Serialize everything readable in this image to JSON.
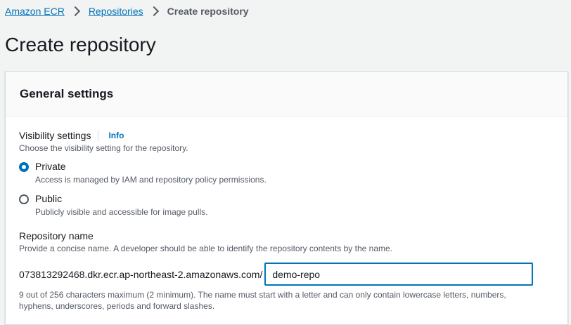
{
  "breadcrumb": {
    "items": [
      {
        "label": "Amazon ECR"
      },
      {
        "label": "Repositories"
      }
    ],
    "current": "Create repository"
  },
  "page": {
    "title": "Create repository"
  },
  "general_settings": {
    "title": "General settings",
    "visibility": {
      "label": "Visibility settings",
      "info_link": "Info",
      "description": "Choose the visibility setting for the repository.",
      "selected": "Private",
      "options": [
        {
          "label": "Private",
          "description": "Access is managed by IAM and repository policy permissions."
        },
        {
          "label": "Public",
          "description": "Publicly visible and accessible for image pulls."
        }
      ]
    },
    "repository_name": {
      "label": "Repository name",
      "description": "Provide a concise name. A developer should be able to identify the repository contents by the name.",
      "uri_prefix": "073813292468.dkr.ecr.ap-northeast-2.amazonaws.com/",
      "value": "demo-repo",
      "constraint_line1": "9 out of 256 characters maximum (2 minimum). The name must start with a letter and can only contain lowercase letters, numbers,",
      "constraint_line2": "hyphens, underscores, periods and forward slashes."
    }
  },
  "colors": {
    "link": "#0073bb",
    "text": "#16191f",
    "secondary_text": "#545b64",
    "page_background": "#f2f3f3",
    "input_focus_border": "#0073bb"
  },
  "icons": {
    "breadcrumb_separator": "chevron-right-icon"
  }
}
